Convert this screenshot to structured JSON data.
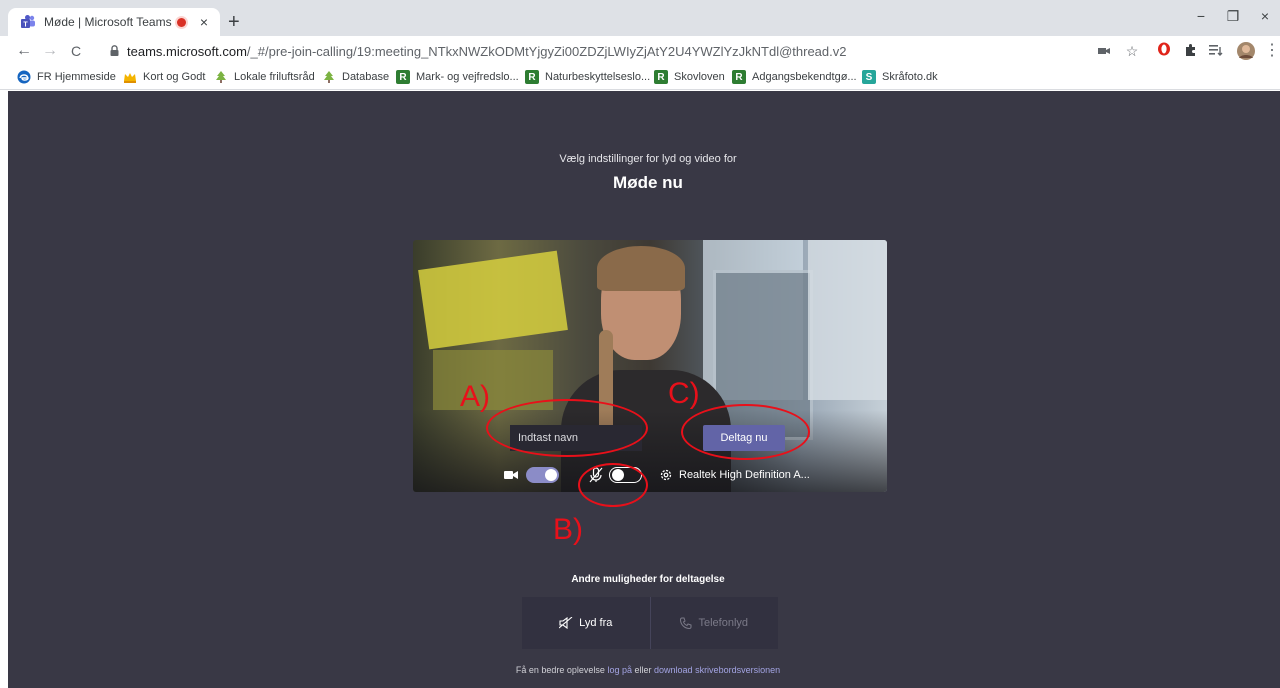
{
  "browser": {
    "tab_title": "Møde | Microsoft Teams",
    "tab_close": "×",
    "new_tab": "+",
    "window_controls": {
      "minimize": "−",
      "restore": "❐",
      "close": "×"
    },
    "nav": {
      "back": "←",
      "forward": "→",
      "reload": "C"
    },
    "url_host": "teams.microsoft.com",
    "url_path": "/_#/pre-join-calling/19:meeting_NTkxNWZkODMtYjgyZi00ZDZjLWIyZjAtY2U4YWZlYzJkNTdl@thread.v2",
    "toolbar_icons": [
      "camera-icon",
      "star-icon",
      "opera-icon",
      "extensions-icon",
      "reading-list-icon",
      "profile-avatar"
    ],
    "bookmarks": [
      {
        "label": "FR Hjemmeside",
        "icon": "edge-icon",
        "color": "#1565c0"
      },
      {
        "label": "Kort og Godt",
        "icon": "crown-icon",
        "color": "#f4b400"
      },
      {
        "label": "Lokale friluftsråd",
        "icon": "tree-icon",
        "color": "#7cb342"
      },
      {
        "label": "Database",
        "icon": "tree-icon",
        "color": "#7cb342"
      },
      {
        "label": "Mark- og vejfredslo...",
        "icon": "R",
        "color": "#2e7d32"
      },
      {
        "label": "Naturbeskyttelseslo...",
        "icon": "R",
        "color": "#2e7d32"
      },
      {
        "label": "Skovloven",
        "icon": "R",
        "color": "#2e7d32"
      },
      {
        "label": "Adgangsbekendtgø...",
        "icon": "R",
        "color": "#2e7d32"
      },
      {
        "label": "Skråfoto.dk",
        "icon": "S",
        "color": "#26a69a"
      }
    ]
  },
  "prejoin": {
    "subtitle": "Vælg indstillinger for lyd og video for",
    "meeting_title": "Møde nu",
    "name_placeholder": "Indtast navn",
    "join_label": "Deltag nu",
    "camera_on": true,
    "mic_on": false,
    "audio_device": "Realtek High Definition A...",
    "annotations": {
      "a": "A)",
      "b": "B)",
      "c": "C)"
    },
    "other_options_title": "Andre muligheder for deltagelse",
    "audio_off_label": "Lyd fra",
    "phone_audio_label": "Telefonlyd",
    "footer_prefix": "Få en bedre oplevelse",
    "footer_login": "log på",
    "footer_or": "eller",
    "footer_download": "download skrivebordsversionen"
  },
  "colors": {
    "accent": "#6264a7",
    "background": "#393845",
    "annotation": "#e8101a"
  }
}
